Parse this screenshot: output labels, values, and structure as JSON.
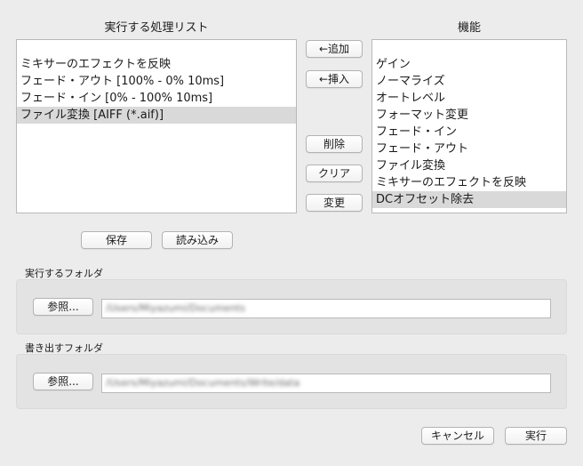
{
  "process_list": {
    "title": "実行する処理リスト",
    "items": [
      "ミキサーのエフェクトを反映",
      "フェード・アウト [100% - 0% 10ms]",
      "フェード・イン [0% - 100% 10ms]",
      "ファイル変換 [AIFF (*.aif)]"
    ],
    "selected_index": 3
  },
  "functions": {
    "title": "機能",
    "items": [
      "ゲイン",
      "ノーマライズ",
      "オートレベル",
      "フォーマット変更",
      "フェード・イン",
      "フェード・アウト",
      "ファイル変換",
      "ミキサーのエフェクトを反映",
      "DCオフセット除去"
    ],
    "selected_index": 8
  },
  "middle_buttons": {
    "add": "←追加",
    "insert": "←挿入",
    "delete": "削除",
    "clear": "クリア",
    "change": "変更"
  },
  "list_buttons": {
    "save": "保存",
    "load": "読み込み"
  },
  "source_folder": {
    "label": "実行するフォルダ",
    "browse": "参照...",
    "path": "/Users/Miyazumi/Documents"
  },
  "output_folder": {
    "label": "書き出すフォルダ",
    "browse": "参照...",
    "path": "/Users/Miyazumi/Documents/Write/data"
  },
  "footer": {
    "cancel": "キャンセル",
    "run": "実行"
  }
}
